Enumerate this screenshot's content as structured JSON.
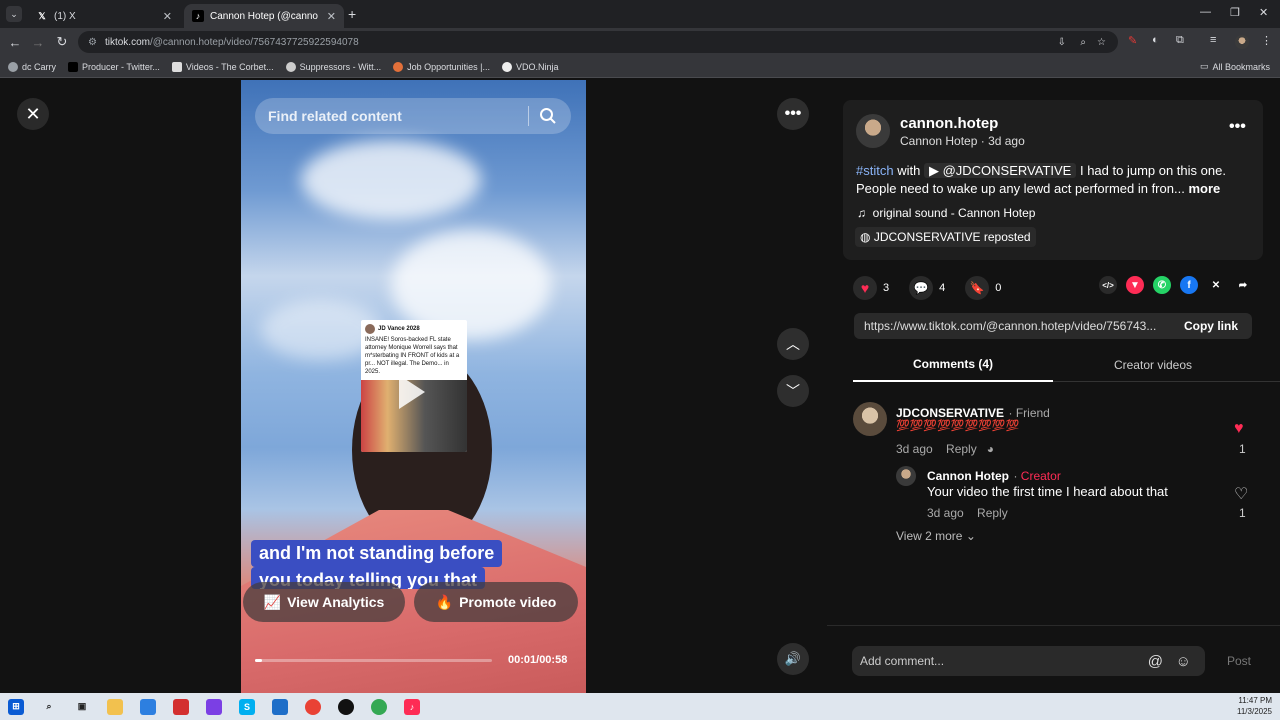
{
  "browser": {
    "tabs": [
      {
        "title": "(1) X",
        "active": false
      },
      {
        "title": "Cannon Hotep (@cannon.hote",
        "active": true
      }
    ],
    "url_domain": "tiktok.com",
    "url_path": "/@cannon.hotep/video/7567437725922594078",
    "bookmarks": [
      "dc Carry",
      "Producer - Twitter...",
      "Videos - The Corbet...",
      "Suppressors - Witt...",
      "Job Opportunities |...",
      "VDO.Ninja"
    ],
    "all_bookmarks": "All Bookmarks"
  },
  "video": {
    "search_placeholder": "Find related content",
    "tweet_author": "JD Vance 2028",
    "tweet_text": "INSANE! Soros-backed FL state attorney Monique Worrell says that m*sterbating IN FRONT of kids at a pr... NOT illegal. The Demo... in 2025.",
    "caption_line1": "and I'm not standing before",
    "caption_line2": "you today telling you that",
    "view_analytics": "View Analytics",
    "promote_video": "Promote video",
    "progress_fraction": 0.03,
    "time": "00:01/00:58"
  },
  "panel": {
    "username": "cannon.hotep",
    "display_name": "Cannon Hotep",
    "posted": "3d ago",
    "desc_hashtag": "#stitch",
    "desc_with": "with",
    "desc_mention": "@JDCONSERVATIVE",
    "desc_text1": "I had to jump on this one.",
    "desc_text2": "People need to wake up any lewd act performed in fron...",
    "more": "more",
    "sound": "original sound - Cannon Hotep",
    "reposted": "JDCONSERVATIVE reposted",
    "likes": "3",
    "comments_count": "4",
    "saves": "0",
    "link": "https://www.tiktok.com/@cannon.hotep/video/756743...",
    "copy_link": "Copy link",
    "tab_comments": "Comments (4)",
    "tab_creator": "Creator videos",
    "comments": [
      {
        "name": "JDCONSERVATIVE",
        "tag": "Friend",
        "text": "💯💯💯💯💯💯💯💯💯",
        "time": "3d ago",
        "reply": "Reply",
        "likes": "1"
      },
      {
        "name": "Cannon Hotep",
        "tag": "Creator",
        "text": "Your video the first time I heard about that",
        "time": "3d ago",
        "reply": "Reply",
        "likes": "1"
      }
    ],
    "view_more": "View 2 more",
    "add_comment_placeholder": "Add comment...",
    "post": "Post"
  },
  "taskbar": {
    "time": "11:47 PM",
    "date": "11/3/2025"
  },
  "colors": {
    "like_red": "#fe2c55",
    "hashtag_blue": "#8ab4f8",
    "caption_bg": "#3a4ec2"
  }
}
